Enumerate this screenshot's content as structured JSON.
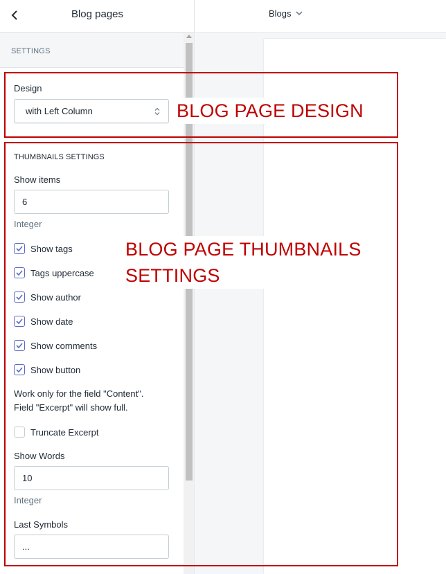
{
  "sidebar": {
    "title": "Blog pages",
    "settings_label": "SETTINGS",
    "design": {
      "label": "Design",
      "value": "with Left Column"
    },
    "thumbnails": {
      "heading": "THUMBNAILS SETTINGS",
      "show_items_label": "Show items",
      "show_items_value": "6",
      "show_items_help": "Integer",
      "checkboxes": [
        {
          "label": "Show tags",
          "checked": true
        },
        {
          "label": "Tags uppercase",
          "checked": true
        },
        {
          "label": "Show author",
          "checked": true
        },
        {
          "label": "Show date",
          "checked": true
        },
        {
          "label": "Show comments",
          "checked": true
        },
        {
          "label": "Show button",
          "checked": true
        }
      ],
      "note_line1": "Work only for the field \"Content\".",
      "note_line2": "Field \"Excerpt\" will show full.",
      "truncate_label": "Truncate Excerpt",
      "truncate_checked": false,
      "show_words_label": "Show Words",
      "show_words_value": "10",
      "show_words_help": "Integer",
      "last_symbols_label": "Last Symbols",
      "last_symbols_value": "..."
    }
  },
  "topbar": {
    "page_selector": "Blogs"
  },
  "annotations": {
    "design_text": "BLOG PAGE DESIGN",
    "thumbs_line1": "BLOG PAGE THUMBNAILS",
    "thumbs_line2": "SETTINGS",
    "color": "#c00000"
  },
  "colors": {
    "accent": "#5c6ac4",
    "annotation": "#c00000"
  }
}
